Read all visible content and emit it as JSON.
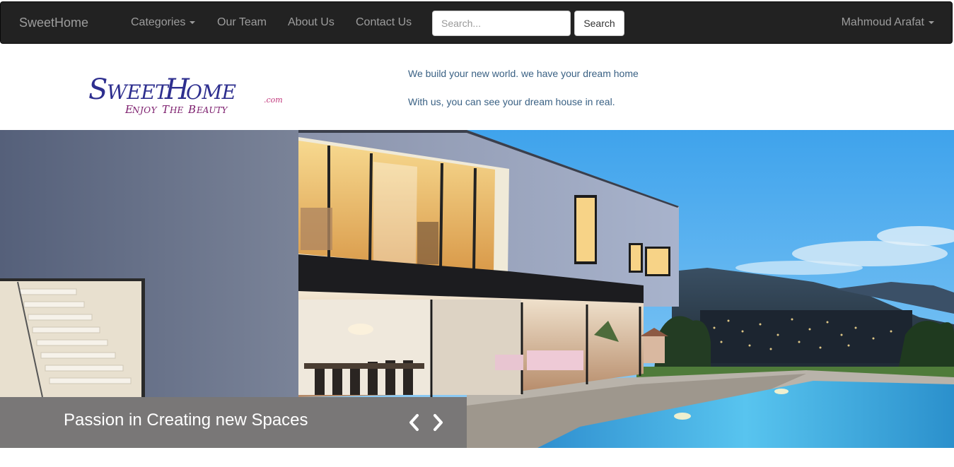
{
  "navbar": {
    "brand": "SweetHome",
    "categories_label": "Categories",
    "links": [
      "Our Team",
      "About Us",
      "Contact Us"
    ],
    "search_placeholder": "Search...",
    "search_button": "Search",
    "user_name": "Mahmoud Arafat"
  },
  "header": {
    "logo_text": "SweetHome.com",
    "logo_slogan": "Enjoy The Beauty",
    "tagline_1": "We build your new world. we have your dream home",
    "tagline_2": "With us, you can see your dream house in real."
  },
  "carousel": {
    "caption": "Passion in Creating new Spaces",
    "prev_icon": "chevron-left-icon",
    "next_icon": "chevron-right-icon"
  },
  "colors": {
    "navbar_bg": "#222222",
    "navbar_text": "#9d9d9d",
    "tagline_text": "#3a6184",
    "logo_blue": "#2e2f8f",
    "logo_purple": "#7a1a6b",
    "caption_bg": "#787471"
  }
}
